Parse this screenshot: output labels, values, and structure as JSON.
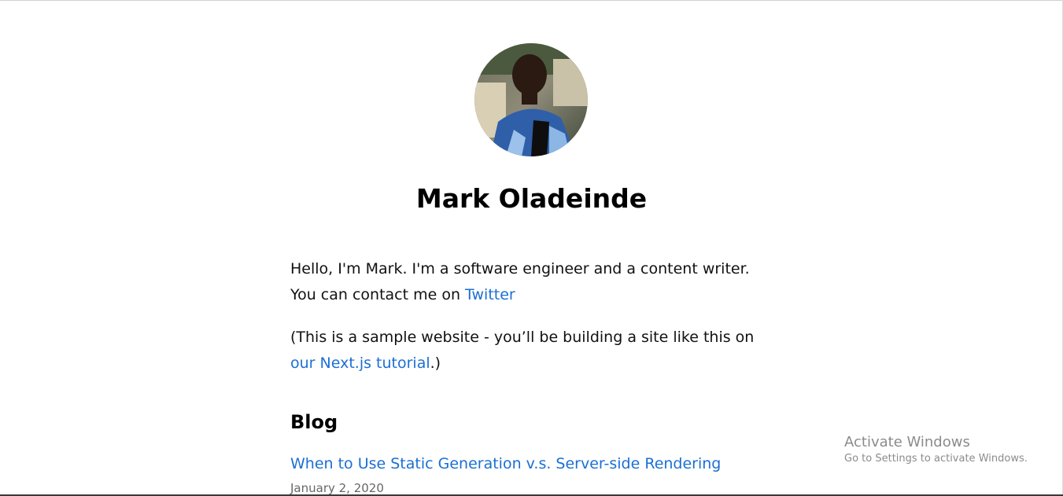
{
  "profile": {
    "name": "Mark Oladeinde",
    "avatar_icon": "profile-photo"
  },
  "intro": {
    "line1": "Hello, I'm Mark. I'm a software engineer and a content writer. You can contact me on ",
    "twitter_link": "Twitter",
    "line2_prefix": "(This is a sample website - you’ll be building a site like this on ",
    "tutorial_link": "our Next.js tutorial",
    "line2_suffix": ".)"
  },
  "blog": {
    "heading": "Blog",
    "posts": [
      {
        "title": "When to Use Static Generation v.s. Server-side Rendering",
        "date": "January 2, 2020"
      }
    ]
  },
  "watermark": {
    "title": "Activate Windows",
    "subtitle": "Go to Settings to activate Windows."
  },
  "colors": {
    "link": "#1a6fd3",
    "text": "#111111",
    "watermark": "#8b8b8b"
  }
}
